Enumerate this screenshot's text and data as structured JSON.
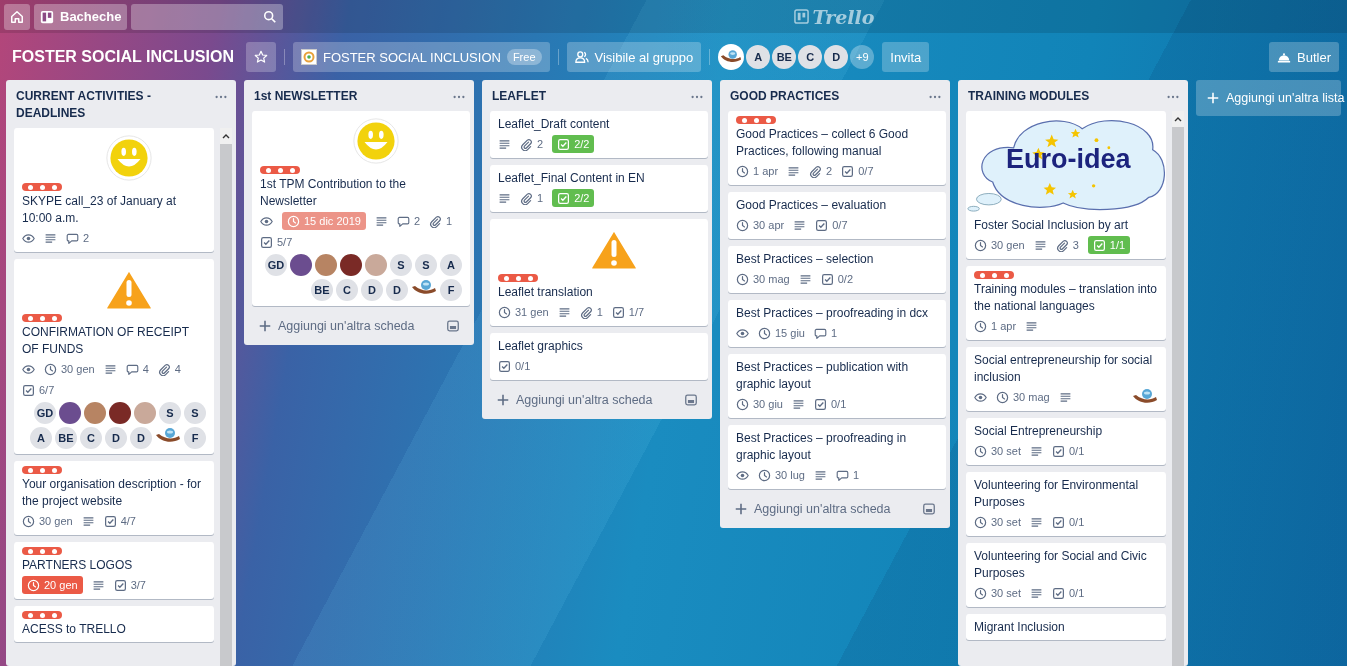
{
  "top_nav": {
    "boards_button": "Bacheche",
    "logo": "Trello"
  },
  "board_header": {
    "title": "FOSTER SOCIAL INCLUSION",
    "starred": false,
    "team": "FOSTER SOCIAL INCLUSION",
    "team_plan": "Free",
    "visibility": "Visibile al gruppo",
    "members": [
      {
        "kind": "hand"
      },
      {
        "kind": "initials",
        "text": "A"
      },
      {
        "kind": "initials",
        "text": "BE"
      },
      {
        "kind": "initials",
        "text": "C"
      },
      {
        "kind": "initials",
        "text": "D"
      }
    ],
    "more_members": "+9",
    "invite": "Invita",
    "butler": "Butler"
  },
  "lists": [
    {
      "title": "CURRENT ACTIVITIES -DEADLINES",
      "scrollbar": true,
      "cards": [
        {
          "cover": {
            "kind": "smiley"
          },
          "labels": [
            {
              "color": "#eb5a46"
            }
          ],
          "title": "SKYPE call_23 of January at 10:00 a.m.",
          "badges": [
            {
              "kind": "watch"
            },
            {
              "kind": "description"
            },
            {
              "kind": "comments",
              "text": "2"
            }
          ]
        },
        {
          "cover": {
            "kind": "warning"
          },
          "labels": [
            {
              "color": "#eb5a46"
            }
          ],
          "title": "CONFIRMATION OF RECEIPT OF FUNDS",
          "badges": [
            {
              "kind": "watch"
            },
            {
              "kind": "due",
              "text": "30 gen"
            },
            {
              "kind": "description"
            },
            {
              "kind": "comments",
              "text": "4"
            },
            {
              "kind": "attachments",
              "text": "4"
            },
            {
              "kind": "checklist",
              "text": "6/7"
            }
          ],
          "members": [
            {
              "kind": "initials",
              "text": "GD"
            },
            {
              "kind": "photo"
            },
            {
              "kind": "photo"
            },
            {
              "kind": "photo"
            },
            {
              "kind": "photo"
            },
            {
              "kind": "initials",
              "text": "S"
            },
            {
              "kind": "initials",
              "text": "S"
            },
            {
              "kind": "initials",
              "text": "A"
            },
            {
              "kind": "initials",
              "text": "BE"
            },
            {
              "kind": "initials",
              "text": "C"
            },
            {
              "kind": "initials",
              "text": "D"
            },
            {
              "kind": "initials",
              "text": "D"
            },
            {
              "kind": "hand"
            },
            {
              "kind": "initials",
              "text": "F"
            }
          ]
        },
        {
          "labels": [
            {
              "color": "#eb5a46"
            }
          ],
          "title": "Your organisation description - for the project website",
          "badges": [
            {
              "kind": "due",
              "text": "30 gen"
            },
            {
              "kind": "description"
            },
            {
              "kind": "checklist",
              "text": "4/7"
            }
          ]
        },
        {
          "labels": [
            {
              "color": "#eb5a46"
            }
          ],
          "title": "PARTNERS LOGOS",
          "badges": [
            {
              "kind": "due",
              "text": "20 gen",
              "color": "#eb5a46"
            },
            {
              "kind": "description"
            },
            {
              "kind": "checklist",
              "text": "3/7"
            }
          ]
        },
        {
          "labels": [
            {
              "color": "#eb5a46"
            }
          ],
          "title": "ACESS to TRELLO"
        }
      ]
    },
    {
      "title": "1st NEWSLETTER",
      "scrollbar": false,
      "cards": [
        {
          "cover": {
            "kind": "smiley"
          },
          "labels": [
            {
              "color": "#eb5a46"
            }
          ],
          "title": "1st TPM Contribution to the Newsletter",
          "badges": [
            {
              "kind": "watch"
            },
            {
              "kind": "due",
              "text": "15 dic 2019",
              "color": "#ec9488"
            },
            {
              "kind": "description"
            },
            {
              "kind": "comments",
              "text": "2"
            },
            {
              "kind": "attachments",
              "text": "1"
            },
            {
              "kind": "checklist",
              "text": "5/7"
            }
          ],
          "members": [
            {
              "kind": "initials",
              "text": "GD"
            },
            {
              "kind": "photo"
            },
            {
              "kind": "photo"
            },
            {
              "kind": "photo"
            },
            {
              "kind": "photo"
            },
            {
              "kind": "initials",
              "text": "S"
            },
            {
              "kind": "initials",
              "text": "S"
            },
            {
              "kind": "initials",
              "text": "A"
            },
            {
              "kind": "initials",
              "text": "BE"
            },
            {
              "kind": "initials",
              "text": "C"
            },
            {
              "kind": "initials",
              "text": "D"
            },
            {
              "kind": "initials",
              "text": "D"
            },
            {
              "kind": "hand"
            },
            {
              "kind": "initials",
              "text": "F"
            }
          ]
        }
      ],
      "add_card": "Aggiungi un'altra scheda"
    },
    {
      "title": "LEAFLET",
      "scrollbar": false,
      "cards": [
        {
          "title": "Leaflet_Draft content",
          "badges": [
            {
              "kind": "description"
            },
            {
              "kind": "attachments",
              "text": "2"
            },
            {
              "kind": "checklist",
              "text": "2/2",
              "color": "#61bd4f"
            }
          ]
        },
        {
          "title": "Leaflet_Final Content in EN",
          "badges": [
            {
              "kind": "description"
            },
            {
              "kind": "attachments",
              "text": "1"
            },
            {
              "kind": "checklist",
              "text": "2/2",
              "color": "#61bd4f"
            }
          ]
        },
        {
          "cover": {
            "kind": "warning"
          },
          "labels": [
            {
              "color": "#eb5a46"
            }
          ],
          "title": "Leaflet translation",
          "badges": [
            {
              "kind": "due",
              "text": "31 gen"
            },
            {
              "kind": "description"
            },
            {
              "kind": "attachments",
              "text": "1"
            },
            {
              "kind": "checklist",
              "text": "1/7"
            }
          ]
        },
        {
          "title": "Leaflet graphics",
          "badges": [
            {
              "kind": "checklist",
              "text": "0/1"
            }
          ]
        }
      ],
      "add_card": "Aggiungi un'altra scheda"
    },
    {
      "title": "GOOD PRACTICES",
      "scrollbar": false,
      "cards": [
        {
          "labels": [
            {
              "color": "#eb5a46"
            }
          ],
          "title": "Good Practices – collect 6 Good Practices, following manual",
          "badges": [
            {
              "kind": "due",
              "text": "1 apr"
            },
            {
              "kind": "description"
            },
            {
              "kind": "attachments",
              "text": "2"
            },
            {
              "kind": "checklist",
              "text": "0/7"
            }
          ]
        },
        {
          "title": "Good Practices – evaluation",
          "badges": [
            {
              "kind": "due",
              "text": "30 apr"
            },
            {
              "kind": "description"
            },
            {
              "kind": "checklist",
              "text": "0/7"
            }
          ]
        },
        {
          "title": "Best Practices – selection",
          "badges": [
            {
              "kind": "due",
              "text": "30 mag"
            },
            {
              "kind": "description"
            },
            {
              "kind": "checklist",
              "text": "0/2"
            }
          ]
        },
        {
          "title": "Best Practices – proofreading in dcx",
          "badges": [
            {
              "kind": "watch"
            },
            {
              "kind": "due",
              "text": "15 giu"
            },
            {
              "kind": "comments",
              "text": "1"
            }
          ]
        },
        {
          "title": "Best Practices – publication with graphic layout",
          "badges": [
            {
              "kind": "due",
              "text": "30 giu"
            },
            {
              "kind": "description"
            },
            {
              "kind": "checklist",
              "text": "0/1"
            }
          ]
        },
        {
          "title": "Best Practices – proofreading in graphic layout",
          "badges": [
            {
              "kind": "watch"
            },
            {
              "kind": "due",
              "text": "30 lug"
            },
            {
              "kind": "description"
            },
            {
              "kind": "comments",
              "text": "1"
            }
          ]
        }
      ],
      "add_card": "Aggiungi un'altra scheda"
    },
    {
      "title": "TRAINING MODULES",
      "scrollbar": true,
      "cards": [
        {
          "cover": {
            "kind": "logo",
            "text": "Euro-idea"
          },
          "title": "Foster Social Inclusion by art",
          "badges": [
            {
              "kind": "due",
              "text": "30 gen"
            },
            {
              "kind": "description"
            },
            {
              "kind": "attachments",
              "text": "3"
            },
            {
              "kind": "checklist",
              "text": "1/1",
              "color": "#61bd4f"
            }
          ]
        },
        {
          "labels": [
            {
              "color": "#eb5a46"
            }
          ],
          "title": "Training modules – translation into the national languages",
          "badges": [
            {
              "kind": "due",
              "text": "1 apr"
            },
            {
              "kind": "description"
            }
          ]
        },
        {
          "title": "Social entrepreneurship for social inclusion",
          "badges": [
            {
              "kind": "watch"
            },
            {
              "kind": "due",
              "text": "30 mag"
            },
            {
              "kind": "description"
            }
          ],
          "members": [
            {
              "kind": "hand"
            }
          ]
        },
        {
          "title": "Social Entrepreneurship",
          "badges": [
            {
              "kind": "due",
              "text": "30 set"
            },
            {
              "kind": "description"
            },
            {
              "kind": "checklist",
              "text": "0/1"
            }
          ]
        },
        {
          "title": "Volunteering for Environmental Purposes",
          "badges": [
            {
              "kind": "due",
              "text": "30 set"
            },
            {
              "kind": "description"
            },
            {
              "kind": "checklist",
              "text": "0/1"
            }
          ]
        },
        {
          "title": "Volunteering for Social and Civic Purposes",
          "badges": [
            {
              "kind": "due",
              "text": "30 set"
            },
            {
              "kind": "description"
            },
            {
              "kind": "checklist",
              "text": "0/1"
            }
          ]
        },
        {
          "title": "Migrant Inclusion"
        }
      ]
    }
  ],
  "add_list": "Aggiungi un'altra lista"
}
